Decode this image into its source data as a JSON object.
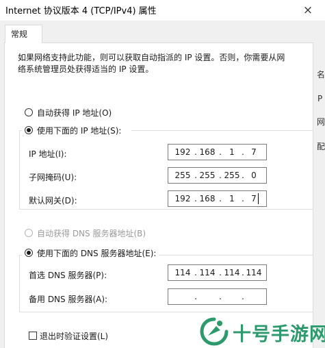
{
  "window": {
    "title": "Internet 协议版本 4 (TCP/IPv4) 属性",
    "close_glyph": "×"
  },
  "tabs": [
    {
      "label": "常规"
    }
  ],
  "right_strip": [
    "名",
    "P",
    "网",
    "配"
  ],
  "general": {
    "description": "如果网络支持此功能，则可以获取自动指派的 IP 设置。否则，你需要从网络系统管理员处获得适当的 IP 设置。",
    "description_line1": "如果网络支持此功能，则可以获取自动指派的 IP 设置。否则，你需要从网",
    "description_line2": "络系统管理员处获得适当的 IP 设置。",
    "ip_mode": {
      "auto_label": "自动获得 IP 地址(O)",
      "manual_label": "使用下面的 IP 地址(S):",
      "selected": "manual"
    },
    "ip_address": {
      "label": "IP 地址(I):",
      "octets": [
        "192",
        "168",
        "1",
        "7"
      ]
    },
    "subnet_mask": {
      "label": "子网掩码(U):",
      "octets": [
        "255",
        "255",
        "255",
        "0"
      ]
    },
    "default_gateway": {
      "label": "默认网关(D):",
      "octets": [
        "192",
        "168",
        "1",
        "7"
      ]
    },
    "dns_mode": {
      "auto_label": "自动获得 DNS 服务器地址(B)",
      "manual_label": "使用下面的 DNS 服务器地址(E):",
      "selected": "manual",
      "auto_disabled": true
    },
    "preferred_dns": {
      "label": "首选 DNS 服务器(P):",
      "octets": [
        "114",
        "114",
        "114",
        "114"
      ]
    },
    "alternate_dns": {
      "label": "备用 DNS 服务器(A):",
      "octets": [
        "",
        "",
        "",
        ""
      ]
    },
    "validate_on_exit": {
      "label": "退出时验证设置(L)",
      "checked": false
    }
  },
  "watermark": {
    "text": "十号手游网",
    "color": "#2b9a6c"
  }
}
